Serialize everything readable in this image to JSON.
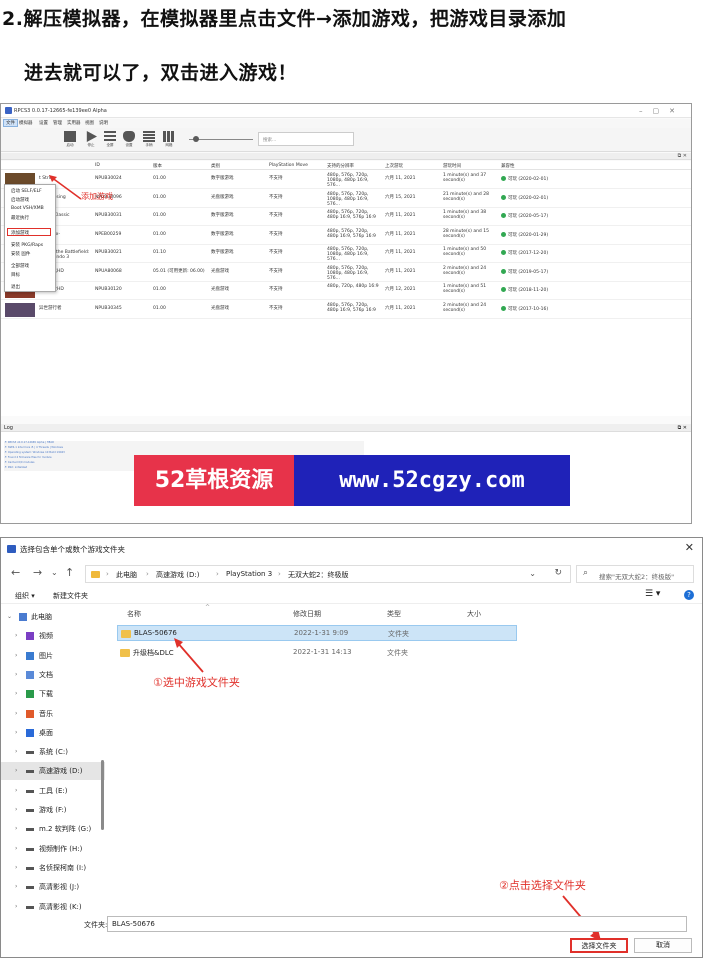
{
  "instructions": {
    "line1": "2.解压模拟器，在模拟器里点击文件→添加游戏，把游戏目录添加",
    "line2": "进去就可以了，双击进入游戏！"
  },
  "rpcs3": {
    "title": "RPCS3 0.0.17-12665-fe139ee0 Alpha",
    "menu": [
      "文件",
      "模拟器",
      "设置",
      "管理",
      "实用器",
      "视图",
      "说明"
    ],
    "toolbar": [
      "启动",
      "停止",
      "全屏",
      "设置",
      "手柄",
      "列表",
      "网格"
    ],
    "search_placeholder": "搜索...",
    "game_list_header": "游戏列表",
    "columns": [
      "ID",
      "版本",
      "类别",
      "PlayStation Move",
      "支持的分辨率",
      "上次游玩",
      "游玩时间",
      "兼容性"
    ],
    "context_menu": [
      "启动 SELF/ELF",
      "启动游戏",
      "Boot VSH/XMB",
      "最近执行",
      "添加游戏",
      "安装 PKG/Raps",
      "安装 固件",
      "全部游戏",
      "目标",
      "退出"
    ],
    "context_highlight": "添加游戏",
    "annotation": "添加游戏",
    "rows": [
      {
        "name": "t Strike",
        "id": "NPUB30024",
        "version": "01.00",
        "category": "数字版游戏",
        "move": "不支持",
        "res": "480p, 576p, 720p, 1080p, 480p 16:9, 576...",
        "last": "六月 11, 2021",
        "time": "1 minute(s) and 37 second(s)",
        "compat": "可玩 (2020-02-01)"
      },
      {
        "name": "ps: Uprising",
        "id": "NPUB30096",
        "version": "01.00",
        "category": "光盘版游戏",
        "move": "不支持",
        "res": "480p, 576p, 720p, 1080p, 480p 16:9, 576...",
        "last": "六月 15, 2021",
        "time": "21 minute(s) and 28 second(s)",
        "compat": "可玩 (2020-02-01)"
      },
      {
        "name": "Persia Classic",
        "id": "NPUB30031",
        "version": "01.00",
        "category": "数字版游戏",
        "move": "不支持",
        "res": "480p, 576p, 720p, 480p 16:9, 576p 16:9",
        "last": "六月 11, 2021",
        "time": "1 minute(s) and 38 second(s)",
        "compat": "可玩 (2020-05-17)"
      },
      {
        "name": "Stack Ex-",
        "id": "NPEB00259",
        "version": "01.00",
        "category": "数字版游戏",
        "move": "不支持",
        "res": "480p, 576p, 720p, 480p 16:9, 576p 16:9",
        "last": "六月 11, 2021",
        "time": "28 minute(s) and 15 second(s)",
        "compat": "可玩 (2020-01-29)"
      },
      {
        "name": "Wolf of the Battlefield: Commando 3",
        "id": "NPUB30021",
        "version": "01.10",
        "category": "数字版游戏",
        "move": "不支持",
        "res": "480p, 576p, 720p, 1080p, 480p 16:9, 576...",
        "last": "六月 11, 2021",
        "time": "1 minute(s) and 50 second(s)",
        "compat": "可玩 (2017-12-20)"
      },
      {
        "name": "最终尖兵HD",
        "id": "NPUA80068",
        "version": "05.01 (可用更新: 06.00)",
        "category": "光盘游戏",
        "move": "不支持",
        "res": "480p, 576p, 720p, 1080p, 480p 16:9, 576...",
        "last": "六月 11, 2021",
        "time": "2 minute(s) and 24 second(s)",
        "compat": "可玩 (2019-05-17)"
      },
      {
        "name": "火焰战士HD",
        "id": "NPUB30120",
        "version": "01.00",
        "category": "光盘游戏",
        "move": "不支持",
        "res": "480p, 720p, 480p 16:9",
        "last": "六月 12, 2021",
        "time": "1 minute(s) and 51 second(s)",
        "compat": "可玩 (2018-11-20)"
      },
      {
        "name": "异世游行者",
        "id": "NPUB30345",
        "version": "01.00",
        "category": "光盘游戏",
        "move": "不支持",
        "res": "480p, 576p, 720p, 480p 16:9, 576p 16:9",
        "last": "六月 11, 2021",
        "time": "2 minute(s) and 24 second(s)",
        "compat": "可玩 (2017-10-16)"
      }
    ],
    "log_header": "Log",
    "log_lines": [
      "·F: RPCS3 v0.0.17-12665 Alpha | HEAD",
      "·F: SSE4.1 Intel Core i5 | 4 Threads | Windows",
      "·F: Operating system: Windows 10 Build 19043",
      "·F: Found 4 firmware files for module",
      "·F: Cached 0/0 modules",
      "·F: RSX: initialized"
    ],
    "banner_left": "52草根资源",
    "banner_right": "www.52cgzy.com"
  },
  "dialog": {
    "title": "选择包含单个或数个游戏文件夹",
    "breadcrumb": [
      "此电脑",
      "高速游戏 (D:)",
      "PlayStation 3",
      "无双大蛇2：终极版"
    ],
    "search_placeholder": "搜索\"无双大蛇2：终极版\"",
    "organize": "组织 ▾",
    "new_folder": "新建文件夹",
    "columns": {
      "name": "名称",
      "modified": "修改日期",
      "type": "类型",
      "size": "大小"
    },
    "files": [
      {
        "name": "BLAS-50676",
        "modified": "2022-1-31 9:09",
        "type": "文件夹"
      },
      {
        "name": "升级档&DLC",
        "modified": "2022-1-31 14:13",
        "type": "文件夹"
      }
    ],
    "nav": [
      "此电脑",
      "视频",
      "图片",
      "文档",
      "下载",
      "音乐",
      "桌面",
      "系统 (C:)",
      "高速游戏 (D:)",
      "工具 (E:)",
      "游戏 (F:)",
      "m.2 软判阵 (G:)",
      "视频制作 (H:)",
      "名侦探柯南 (I:)",
      "高清影视 (J:)",
      "高清影视 (K:)"
    ],
    "annotation1": "①选中游戏文件夹",
    "annotation2": "②点击选择文件夹",
    "filename_label": "文件夹:",
    "filename_value": "BLAS-50676",
    "select_button": "选择文件夹",
    "cancel_button": "取消",
    "colors": {
      "annotation": "#e0302a",
      "selection": "#cce4f7",
      "folder": "#f0c04a"
    }
  }
}
